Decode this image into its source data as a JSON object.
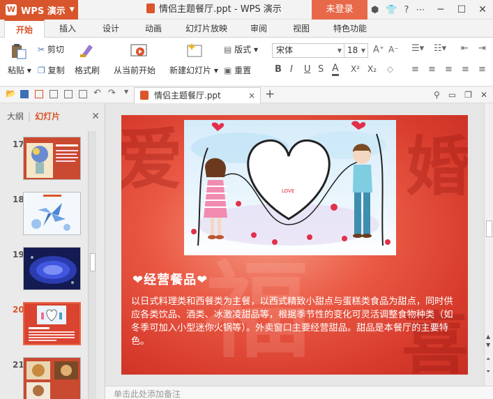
{
  "titlebar": {
    "app_name": "WPS 演示",
    "doc_title": "情侣主题餐厅.ppt - WPS 演示",
    "login": "未登录"
  },
  "tabs": [
    "开始",
    "插入",
    "设计",
    "动画",
    "幻灯片放映",
    "审阅",
    "视图",
    "特色功能"
  ],
  "ribbon": {
    "paste": "粘贴",
    "cut": "剪切",
    "copy": "复制",
    "format_painter": "格式刷",
    "from_current": "从当前开始",
    "new_slide": "新建幻灯片",
    "layout": "版式",
    "reset": "重置",
    "font": "宋体",
    "font_size": "18"
  },
  "doc_tab": "情侣主题餐厅.ppt",
  "panel": {
    "outline_tab": "大纲",
    "slides_tab": "幻灯片",
    "thumbnails": [
      "17",
      "18",
      "19",
      "20",
      "21"
    ]
  },
  "slide": {
    "heading": "❤经营餐品❤",
    "body": "以日式料理类和西餐类为主餐，以西式精致小甜点与蛋糕类食品为甜点，同时供应各类饮品、酒类、冰激凌甜品等，根据季节性的变化可灵活调整食物种类（如冬季可加入小型迷你火锅等）。外卖窗口主要经营甜品。甜品是本餐厅的主要特色。",
    "illustration_text": "LOVE"
  },
  "notes_placeholder": "单击此处添加备注"
}
